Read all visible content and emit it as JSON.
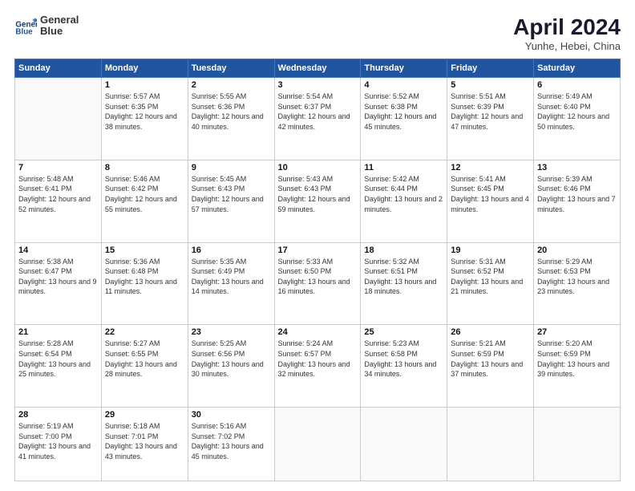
{
  "header": {
    "logo_line1": "General",
    "logo_line2": "Blue",
    "month_year": "April 2024",
    "location": "Yunhe, Hebei, China"
  },
  "weekdays": [
    "Sunday",
    "Monday",
    "Tuesday",
    "Wednesday",
    "Thursday",
    "Friday",
    "Saturday"
  ],
  "weeks": [
    [
      {
        "day": null
      },
      {
        "day": "1",
        "sunrise": "5:57 AM",
        "sunset": "6:35 PM",
        "daylight": "12 hours and 38 minutes."
      },
      {
        "day": "2",
        "sunrise": "5:55 AM",
        "sunset": "6:36 PM",
        "daylight": "12 hours and 40 minutes."
      },
      {
        "day": "3",
        "sunrise": "5:54 AM",
        "sunset": "6:37 PM",
        "daylight": "12 hours and 42 minutes."
      },
      {
        "day": "4",
        "sunrise": "5:52 AM",
        "sunset": "6:38 PM",
        "daylight": "12 hours and 45 minutes."
      },
      {
        "day": "5",
        "sunrise": "5:51 AM",
        "sunset": "6:39 PM",
        "daylight": "12 hours and 47 minutes."
      },
      {
        "day": "6",
        "sunrise": "5:49 AM",
        "sunset": "6:40 PM",
        "daylight": "12 hours and 50 minutes."
      }
    ],
    [
      {
        "day": "7",
        "sunrise": "5:48 AM",
        "sunset": "6:41 PM",
        "daylight": "12 hours and 52 minutes."
      },
      {
        "day": "8",
        "sunrise": "5:46 AM",
        "sunset": "6:42 PM",
        "daylight": "12 hours and 55 minutes."
      },
      {
        "day": "9",
        "sunrise": "5:45 AM",
        "sunset": "6:43 PM",
        "daylight": "12 hours and 57 minutes."
      },
      {
        "day": "10",
        "sunrise": "5:43 AM",
        "sunset": "6:43 PM",
        "daylight": "12 hours and 59 minutes."
      },
      {
        "day": "11",
        "sunrise": "5:42 AM",
        "sunset": "6:44 PM",
        "daylight": "13 hours and 2 minutes."
      },
      {
        "day": "12",
        "sunrise": "5:41 AM",
        "sunset": "6:45 PM",
        "daylight": "13 hours and 4 minutes."
      },
      {
        "day": "13",
        "sunrise": "5:39 AM",
        "sunset": "6:46 PM",
        "daylight": "13 hours and 7 minutes."
      }
    ],
    [
      {
        "day": "14",
        "sunrise": "5:38 AM",
        "sunset": "6:47 PM",
        "daylight": "13 hours and 9 minutes."
      },
      {
        "day": "15",
        "sunrise": "5:36 AM",
        "sunset": "6:48 PM",
        "daylight": "13 hours and 11 minutes."
      },
      {
        "day": "16",
        "sunrise": "5:35 AM",
        "sunset": "6:49 PM",
        "daylight": "13 hours and 14 minutes."
      },
      {
        "day": "17",
        "sunrise": "5:33 AM",
        "sunset": "6:50 PM",
        "daylight": "13 hours and 16 minutes."
      },
      {
        "day": "18",
        "sunrise": "5:32 AM",
        "sunset": "6:51 PM",
        "daylight": "13 hours and 18 minutes."
      },
      {
        "day": "19",
        "sunrise": "5:31 AM",
        "sunset": "6:52 PM",
        "daylight": "13 hours and 21 minutes."
      },
      {
        "day": "20",
        "sunrise": "5:29 AM",
        "sunset": "6:53 PM",
        "daylight": "13 hours and 23 minutes."
      }
    ],
    [
      {
        "day": "21",
        "sunrise": "5:28 AM",
        "sunset": "6:54 PM",
        "daylight": "13 hours and 25 minutes."
      },
      {
        "day": "22",
        "sunrise": "5:27 AM",
        "sunset": "6:55 PM",
        "daylight": "13 hours and 28 minutes."
      },
      {
        "day": "23",
        "sunrise": "5:25 AM",
        "sunset": "6:56 PM",
        "daylight": "13 hours and 30 minutes."
      },
      {
        "day": "24",
        "sunrise": "5:24 AM",
        "sunset": "6:57 PM",
        "daylight": "13 hours and 32 minutes."
      },
      {
        "day": "25",
        "sunrise": "5:23 AM",
        "sunset": "6:58 PM",
        "daylight": "13 hours and 34 minutes."
      },
      {
        "day": "26",
        "sunrise": "5:21 AM",
        "sunset": "6:59 PM",
        "daylight": "13 hours and 37 minutes."
      },
      {
        "day": "27",
        "sunrise": "5:20 AM",
        "sunset": "6:59 PM",
        "daylight": "13 hours and 39 minutes."
      }
    ],
    [
      {
        "day": "28",
        "sunrise": "5:19 AM",
        "sunset": "7:00 PM",
        "daylight": "13 hours and 41 minutes."
      },
      {
        "day": "29",
        "sunrise": "5:18 AM",
        "sunset": "7:01 PM",
        "daylight": "13 hours and 43 minutes."
      },
      {
        "day": "30",
        "sunrise": "5:16 AM",
        "sunset": "7:02 PM",
        "daylight": "13 hours and 45 minutes."
      },
      {
        "day": null
      },
      {
        "day": null
      },
      {
        "day": null
      },
      {
        "day": null
      }
    ]
  ]
}
